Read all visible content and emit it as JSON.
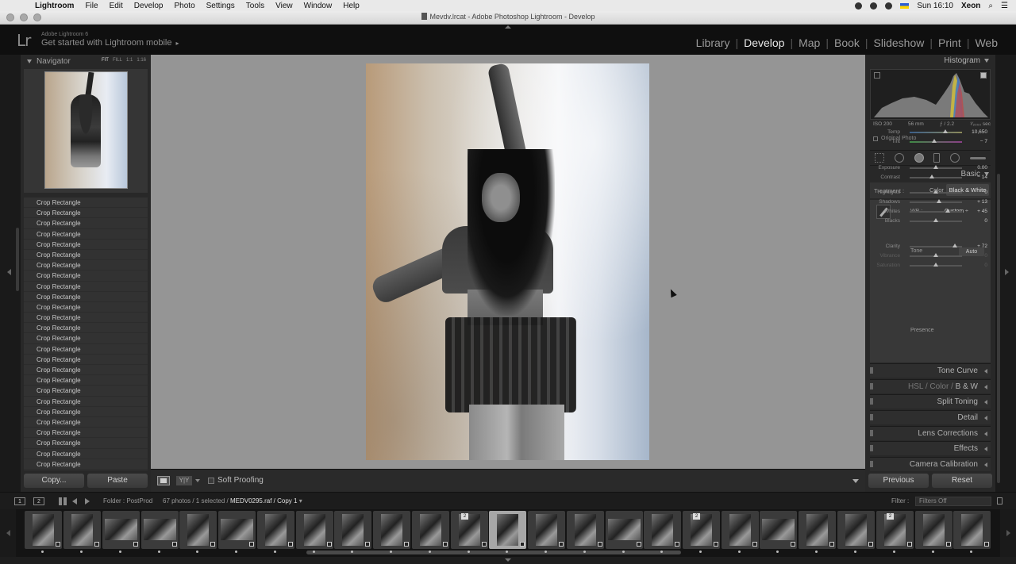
{
  "menubar": {
    "app": "Lightroom",
    "menus": [
      "File",
      "Edit",
      "Develop",
      "Photo",
      "Settings",
      "Tools",
      "View",
      "Window",
      "Help"
    ],
    "clock": "Sun 16:10",
    "user": "Xeon"
  },
  "window": {
    "title": "Mevdv.lrcat - Adobe Photoshop Lightroom - Develop"
  },
  "identity": {
    "logo": "Lr",
    "version": "Adobe Lightroom 6",
    "mobile_prompt": "Get started with Lightroom mobile",
    "mobile_arrow": "▸"
  },
  "modules": [
    "Library",
    "Develop",
    "Map",
    "Book",
    "Slideshow",
    "Print",
    "Web"
  ],
  "active_module": "Develop",
  "navigator": {
    "title": "Navigator",
    "zooms": [
      "FIT",
      "FILL",
      "1:1",
      "1:16"
    ]
  },
  "history": {
    "items": [
      "Crop Rectangle",
      "Crop Rectangle",
      "Crop Rectangle",
      "Crop Rectangle",
      "Crop Rectangle",
      "Crop Rectangle",
      "Crop Rectangle",
      "Crop Rectangle",
      "Crop Rectangle",
      "Crop Rectangle",
      "Crop Rectangle",
      "Crop Rectangle",
      "Crop Rectangle",
      "Crop Rectangle",
      "Crop Rectangle",
      "Crop Rectangle",
      "Crop Rectangle",
      "Crop Rectangle",
      "Crop Rectangle",
      "Crop Rectangle",
      "Crop Rectangle",
      "Crop Rectangle",
      "Crop Rectangle",
      "Crop Rectangle",
      "Crop Rectangle",
      "Crop Rectangle"
    ]
  },
  "left_buttons": {
    "copy": "Copy...",
    "paste": "Paste"
  },
  "toolbar": {
    "soft_proofing": "Soft Proofing",
    "yy": "Y|Y"
  },
  "histogram": {
    "title": "Histogram",
    "iso": "ISO 200",
    "focal": "56 mm",
    "aperture": "ƒ / 2.2",
    "shutter": "¹⁄₂₀₀₀ sec",
    "original_photo": "Original Photo"
  },
  "basic": {
    "title": "Basic",
    "treatment_label": "Treatment :",
    "treatment_color": "Color",
    "treatment_bw": "Black & White",
    "wb_label": "WB :",
    "wb_value": "Custom ÷",
    "tone_label": "Tone",
    "auto": "Auto",
    "presence_label": "Presence",
    "sliders": [
      {
        "key": "temp",
        "label": "Temp",
        "value": "10,650",
        "pos": 0.68
      },
      {
        "key": "tint",
        "label": "Tint",
        "value": "− 7",
        "pos": 0.47
      },
      {
        "key": "exposure",
        "label": "Exposure",
        "value": "0.00",
        "pos": 0.5
      },
      {
        "key": "contrast",
        "label": "Contrast",
        "value": "− 14",
        "pos": 0.43
      },
      {
        "key": "highlights",
        "label": "Highlights",
        "value": "0",
        "pos": 0.5
      },
      {
        "key": "shadows",
        "label": "Shadows",
        "value": "+ 13",
        "pos": 0.56
      },
      {
        "key": "whites",
        "label": "Whites",
        "value": "+ 45",
        "pos": 0.72
      },
      {
        "key": "blacks",
        "label": "Blacks",
        "value": "0",
        "pos": 0.5
      },
      {
        "key": "clarity",
        "label": "Clarity",
        "value": "+ 72",
        "pos": 0.86
      },
      {
        "key": "vibrance",
        "label": "Vibrance",
        "value": "0",
        "pos": 0.5
      },
      {
        "key": "saturation",
        "label": "Saturation",
        "value": "0",
        "pos": 0.5
      }
    ]
  },
  "sections": {
    "tone_curve": "Tone Curve",
    "hsl": "HSL",
    "color": "Color",
    "bw": "B & W",
    "split_toning": "Split Toning",
    "detail": "Detail",
    "lens_corrections": "Lens Corrections",
    "effects": "Effects",
    "camera_calibration": "Camera Calibration"
  },
  "right_buttons": {
    "previous": "Previous",
    "reset": "Reset"
  },
  "filmstrip_bar": {
    "monitor1": "1",
    "monitor2": "2",
    "folder": "Folder : PostProd",
    "count": "67 photos / 1 selected /",
    "selected_file": "MEDV0295.raf / Copy 1",
    "filter_label": "Filter :",
    "filter_value": "Filters Off"
  },
  "filmstrip": {
    "stack_badge": "2"
  }
}
